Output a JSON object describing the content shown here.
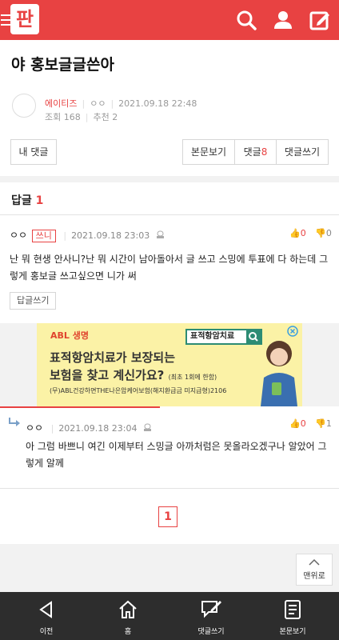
{
  "header": {
    "logo_text": "판"
  },
  "post": {
    "title": "야 홍보글글쓴아",
    "author": "에이티즈",
    "nickname": "ㅇㅇ",
    "datetime": "2021.09.18 22:48",
    "views": "조회 168",
    "recommends": "추천 2"
  },
  "actions": {
    "my_comments": "내 댓글",
    "view_post": "본문보기",
    "comments_label": "댓글",
    "comments_count": "8",
    "write_comment": "댓글쓰기"
  },
  "replies": {
    "label": "답글",
    "count": "1"
  },
  "comment": {
    "nickname": "ㅇㅇ",
    "tag": "쓰니",
    "datetime": "2021.09.18 23:03",
    "likes": "0",
    "dislikes": "0",
    "text": "난 뭐 현생 안사니?난 뭐 시간이 남아돌아서 글 쓰고 스밍에 투표에 다 하는데 그렇게 홍보글 쓰고싶으면 니가 써",
    "reply_button": "답글쓰기"
  },
  "ad": {
    "brand": "ABL 생명",
    "search_text": "표적항암치료",
    "line1": "표적항암치료가 보장되는",
    "line2": "보험을 찾고 계신가요?",
    "line2_small": "(최초 1회에 한함)",
    "footer": "(무)ABL건강하면THE나은암케어보험(해지환급금 미지급형)2106"
  },
  "reply": {
    "nickname": "ㅇㅇ",
    "datetime": "2021.09.18 23:04",
    "likes": "0",
    "dislikes": "1",
    "text": "아 그럼 바쁘니 여긴 이제부터 스밍글 아까처럼은 못올라오겠구나 알았어 그렇게 알께"
  },
  "pagination": {
    "current": "1"
  },
  "to_top": "맨위로",
  "bottom_nav": {
    "prev": "이전",
    "home": "홈",
    "write_comment": "댓글쓰기",
    "view_post": "본문보기"
  },
  "colors": {
    "brand": "#e84242",
    "nav_bg": "#2d2d2d",
    "ad_bg": "#fbf2a6"
  }
}
